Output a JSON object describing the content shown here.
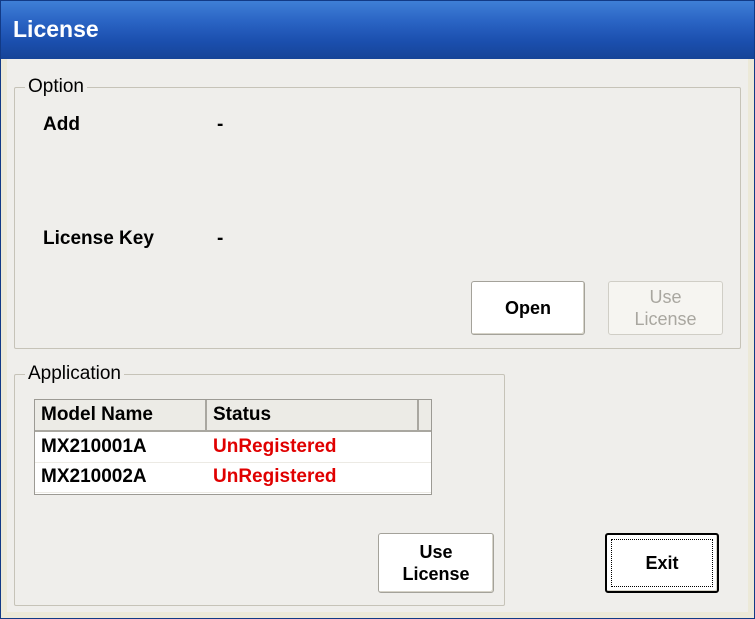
{
  "window": {
    "title": "License"
  },
  "option": {
    "group_label": "Option",
    "add_label": "Add",
    "add_value": "-",
    "license_key_label": "License Key",
    "license_key_value": "-",
    "open_button": "Open",
    "use_license_button_line1": "Use",
    "use_license_button_line2": "License"
  },
  "application": {
    "group_label": "Application",
    "columns": [
      "Model Name",
      "Status"
    ],
    "rows": [
      {
        "model": "MX210001A",
        "status": "UnRegistered"
      },
      {
        "model": "MX210002A",
        "status": "UnRegistered"
      }
    ],
    "use_license_button_line1": "Use",
    "use_license_button_line2": "License"
  },
  "exit_button": "Exit",
  "colors": {
    "titlebar": "#2a64c4",
    "status_unregistered": "#e00000"
  }
}
